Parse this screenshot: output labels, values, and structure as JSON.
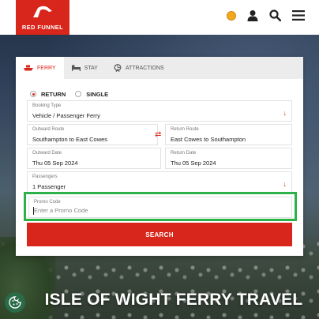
{
  "brand": {
    "name": "RED FUNNEL",
    "color": "#d9261c"
  },
  "header": {
    "icons": [
      "status-dot-icon",
      "user-icon",
      "search-icon",
      "menu-icon"
    ]
  },
  "tabs": [
    {
      "label": "FERRY",
      "icon": "ferry-icon",
      "active": true
    },
    {
      "label": "STAY",
      "icon": "bed-icon",
      "active": false
    },
    {
      "label": "ATTRACTIONS",
      "icon": "attractions-icon",
      "active": false
    }
  ],
  "trip_type": {
    "options": [
      {
        "label": "RETURN",
        "selected": true
      },
      {
        "label": "SINGLE",
        "selected": false
      }
    ]
  },
  "booking_type": {
    "label": "Booking Type",
    "value": "Vehicle / Passenger Ferry"
  },
  "outward_route": {
    "label": "Outward Route",
    "value": "Southampton to East Cowes"
  },
  "return_route": {
    "label": "Return Route",
    "value": "East Cowes to Southampton"
  },
  "outward_date": {
    "label": "Outward Date",
    "value": "Thu 05 Sep 2024"
  },
  "return_date": {
    "label": "Return Date",
    "value": "Thu 05 Sep 2024"
  },
  "passengers": {
    "label": "Passengers",
    "value": "1 Passenger"
  },
  "promo_code": {
    "label": "Promo Code",
    "value": "",
    "placeholder": "Enter a Promo Code"
  },
  "search_button": {
    "label": "SEARCH"
  },
  "hero": {
    "title": "ISLE OF WIGHT FERRY TRAVEL"
  },
  "colors": {
    "accent": "#d9261c",
    "highlight": "#2db24a",
    "status_dot": "#f2a81d"
  }
}
